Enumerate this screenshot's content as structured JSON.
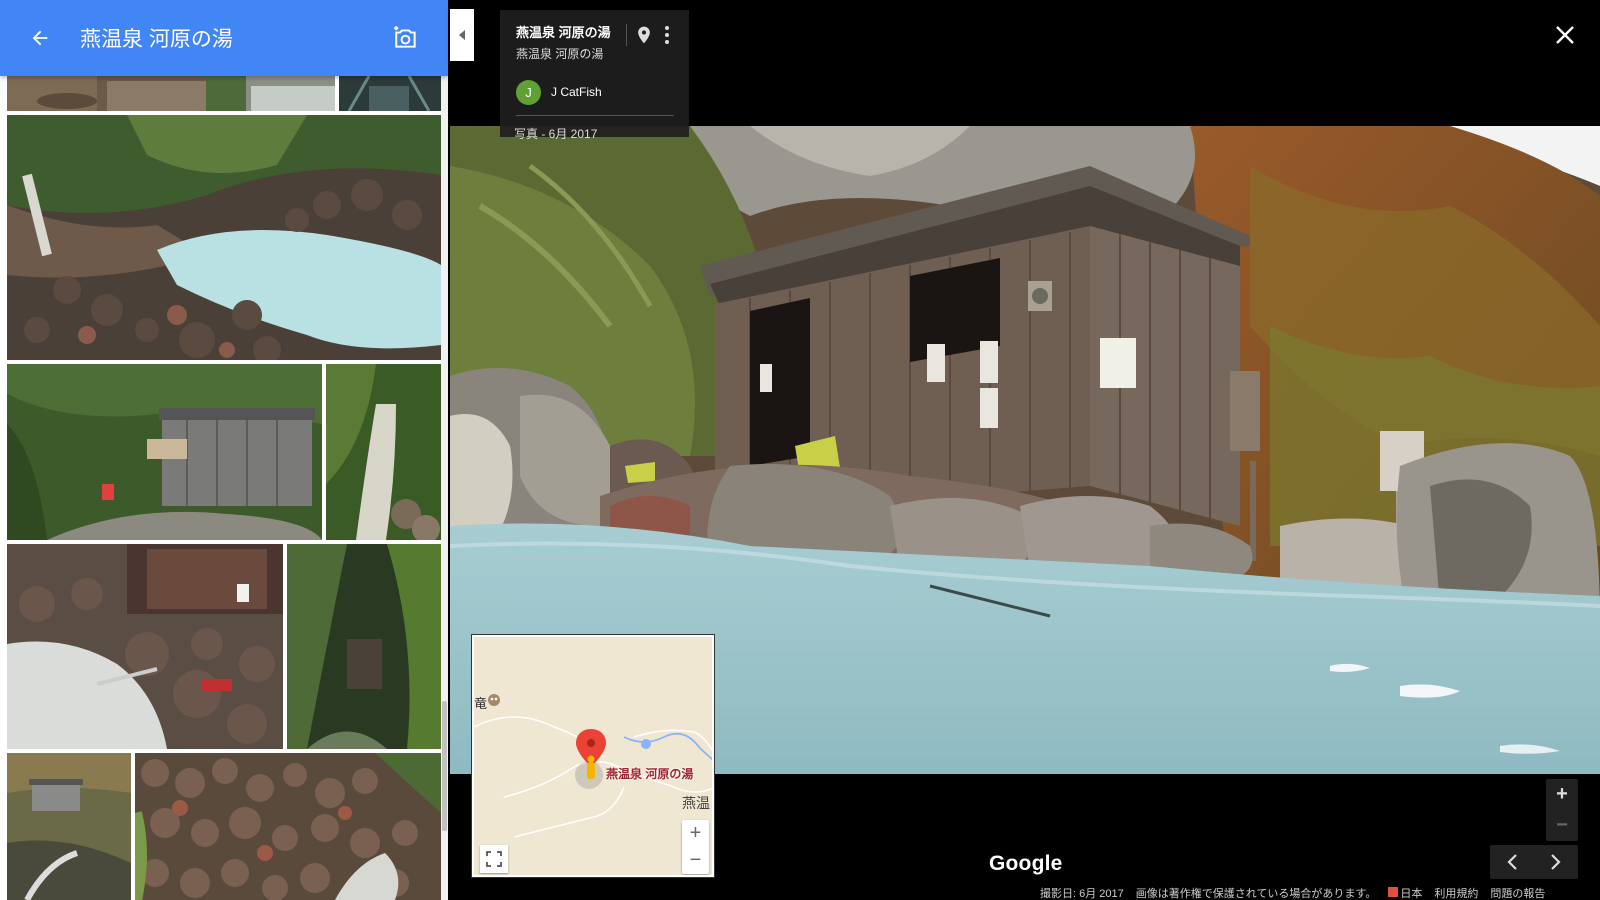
{
  "header": {
    "title": "燕温泉 河原の湯"
  },
  "info_card": {
    "title": "燕温泉 河原の湯",
    "subtitle": "燕温泉 河原の湯",
    "avatar_initial": "J",
    "user_name": "J CatFish",
    "date": "写真 - 6月 2017"
  },
  "minimap": {
    "place_label": "燕温泉 河原の湯",
    "left_label": "竜",
    "right_label": "燕温",
    "zoom_in": "+",
    "zoom_out": "−"
  },
  "controls": {
    "zoom_in": "+",
    "zoom_out": "−"
  },
  "branding": {
    "logo": "Google"
  },
  "footer": {
    "capture_date": "撮影日: 6月 2017",
    "copyright": "画像は著作権で保護されている場合があります。",
    "region": "日本",
    "terms": "利用規約",
    "report": "問題の報告"
  },
  "colors": {
    "header_bg": "#4285f4",
    "avatar_bg": "#5fa133",
    "map_pin": "#ea4335",
    "map_label": "#a1232f",
    "water": "#9fc7cc"
  },
  "icons": {
    "back": "arrow-left-icon",
    "camera": "add-photo-icon",
    "collapse": "triangle-left-icon",
    "pin": "map-pin-icon",
    "more": "more-vertical-icon",
    "close": "close-icon",
    "expand": "fullscreen-icon",
    "prev": "chevron-left-icon",
    "next": "chevron-right-icon"
  }
}
